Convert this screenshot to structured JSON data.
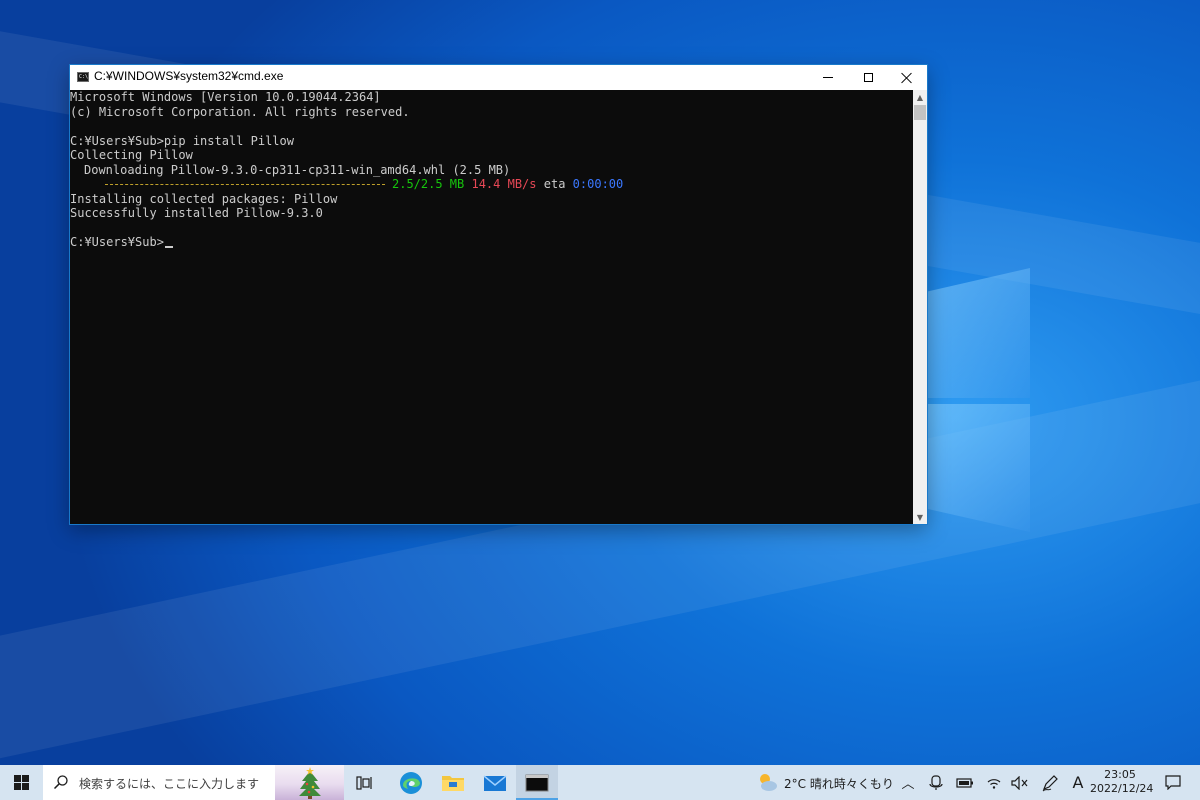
{
  "window": {
    "title": "C:¥WINDOWS¥system32¥cmd.exe",
    "console_bg": "#0c0c0c",
    "console_text_color": "#cccccc"
  },
  "console": {
    "line1": "Microsoft Windows [Version 10.0.19044.2364]",
    "line2": "(c) Microsoft Corporation. All rights reserved.",
    "prompt1": "C:¥Users¥Sub>pip install Pillow",
    "collecting": "Collecting Pillow",
    "downloading": "Downloading Pillow-9.3.0-cp311-cp311-win_amd64.whl (2.5 MB)",
    "progress": {
      "bar": "----------------------------------------",
      "size": "2.5/2.5 MB",
      "speed": "14.4 MB/s",
      "eta_label": "eta",
      "eta": "0:00:00",
      "percent_complete": 100
    },
    "installing": "Installing collected packages: Pillow",
    "success": "Successfully installed Pillow-9.3.0",
    "prompt2": "C:¥Users¥Sub>"
  },
  "taskbar": {
    "search_placeholder": "検索するには、ここに入力します",
    "weather": "2°C  晴れ時々くもり",
    "ime": "A",
    "time": "23:05",
    "date": "2022/12/24",
    "accent": "#4da2e6"
  },
  "icons": {
    "start": "windows-logo-icon",
    "search": "search-icon",
    "task_view": "task-view-icon",
    "edge": "edge-icon",
    "explorer": "folder-icon",
    "mail": "mail-icon",
    "cmd": "terminal-icon"
  }
}
